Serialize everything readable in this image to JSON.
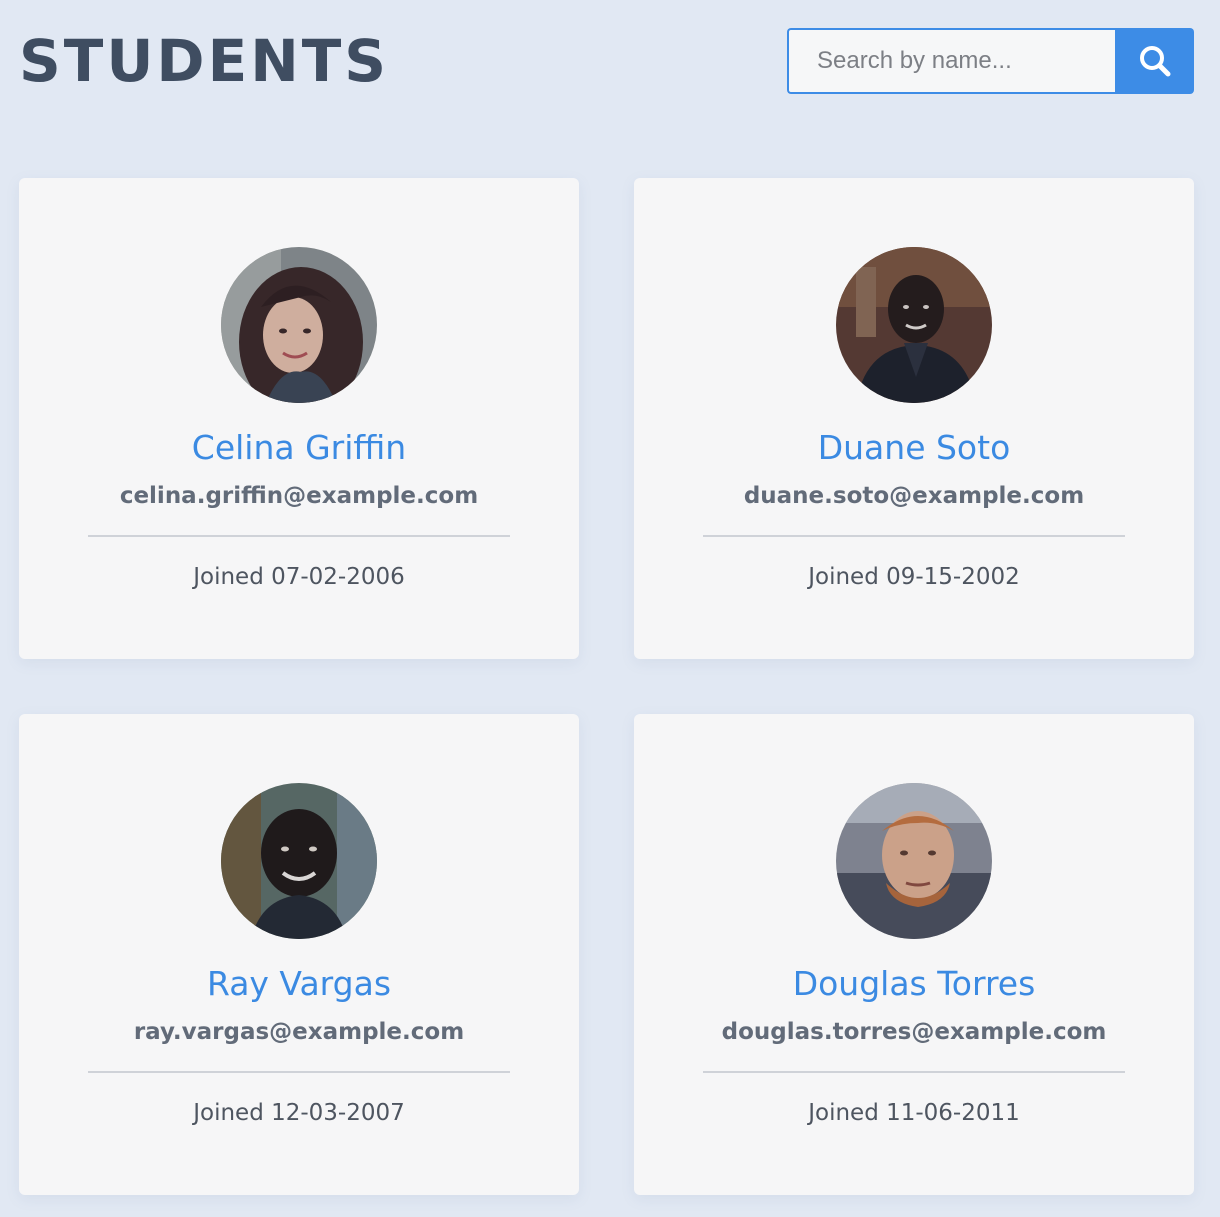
{
  "header": {
    "title": "STUDENTS",
    "search_placeholder": "Search by name...",
    "search_value": "",
    "search_icon": "search-icon"
  },
  "colors": {
    "background": "#e1e8f3",
    "accent": "#3d8ce6",
    "card": "#f6f6f7",
    "name": "#3b8ae2",
    "email": "#626b79",
    "title": "#3f4d61"
  },
  "students": [
    {
      "name": "Celina Griffin",
      "email": "celina.griffin@example.com",
      "joined": "Joined 07-02-2006"
    },
    {
      "name": "Duane Soto",
      "email": "duane.soto@example.com",
      "joined": "Joined 09-15-2002"
    },
    {
      "name": "Ray Vargas",
      "email": "ray.vargas@example.com",
      "joined": "Joined 12-03-2007"
    },
    {
      "name": "Douglas Torres",
      "email": "douglas.torres@example.com",
      "joined": "Joined 11-06-2011"
    }
  ]
}
